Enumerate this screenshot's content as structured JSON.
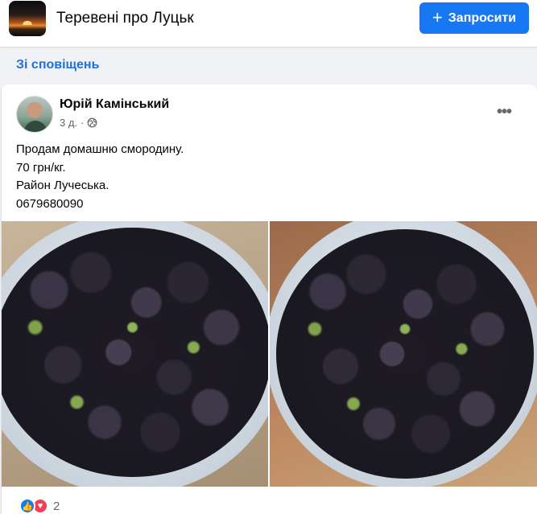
{
  "header": {
    "group_name": "Теревені про Луцьк",
    "invite_label": "Запросити",
    "invite_icon": "plus-icon"
  },
  "notification_link": "Зі сповіщень",
  "post": {
    "author": "Юрій Камінський",
    "time": "3 д.",
    "privacy_icon": "globe-icon",
    "more_icon": "more-horizontal-icon",
    "text_lines": [
      "Продам домашню смородину.",
      "70 грн/кг.",
      "Район Лучеська.",
      "0679680090"
    ],
    "photos": [
      {
        "subject": "blackcurrants-bowl-photo-1"
      },
      {
        "subject": "blackcurrants-bowl-photo-2"
      }
    ],
    "reactions": {
      "icons": [
        "like-icon",
        "love-icon"
      ],
      "count": "2"
    }
  },
  "colors": {
    "accent": "#1877f2",
    "link": "#216fdb",
    "background": "#f0f2f5",
    "love": "#f33e58"
  }
}
